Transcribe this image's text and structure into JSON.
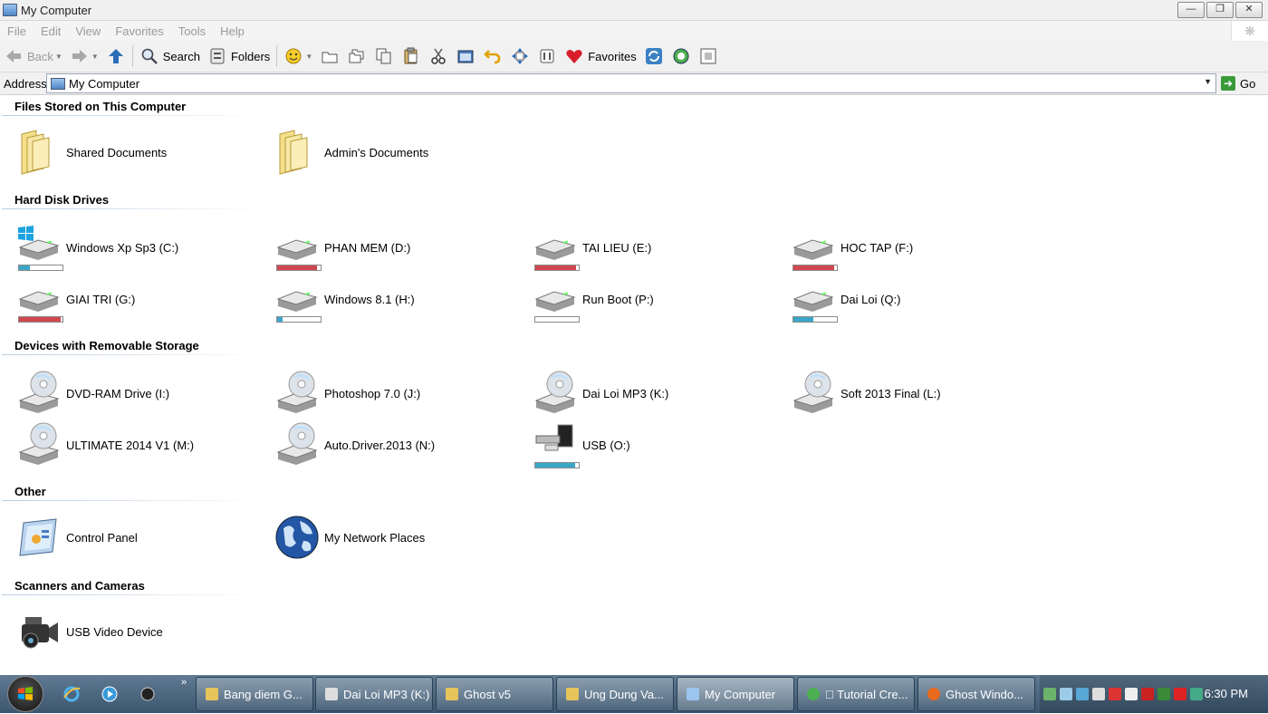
{
  "window": {
    "title": "My Computer"
  },
  "menu": [
    "File",
    "Edit",
    "View",
    "Favorites",
    "Tools",
    "Help"
  ],
  "toolbar": {
    "back": "Back",
    "search": "Search",
    "folders": "Folders",
    "favorites": "Favorites"
  },
  "address": {
    "label": "Address",
    "value": "My Computer",
    "go": "Go"
  },
  "groups": {
    "files": {
      "title": "Files Stored on This Computer",
      "items": [
        {
          "label": "Shared Documents"
        },
        {
          "label": "Admin's Documents"
        }
      ]
    },
    "hdd": {
      "title": "Hard Disk Drives",
      "items": [
        {
          "label": "Windows Xp Sp3 (C:)",
          "usage": 0.25,
          "color": "#3aa6c8"
        },
        {
          "label": "PHAN MEM (D:)",
          "usage": 0.92,
          "color": "#d0484f"
        },
        {
          "label": "TAI LIEU (E:)",
          "usage": 0.94,
          "color": "#d0484f"
        },
        {
          "label": "HOC TAP (F:)",
          "usage": 0.93,
          "color": "#d0484f"
        },
        {
          "label": "GIAI TRI (G:)",
          "usage": 0.95,
          "color": "#d0484f"
        },
        {
          "label": "Windows 8.1 (H:)",
          "usage": 0.12,
          "color": "#3aa6c8"
        },
        {
          "label": "Run Boot (P:)",
          "usage": 0.0,
          "color": "#3aa6c8"
        },
        {
          "label": "Dai Loi (Q:)",
          "usage": 0.45,
          "color": "#3aa6c8"
        }
      ]
    },
    "removable": {
      "title": "Devices with Removable Storage",
      "items": [
        {
          "label": "DVD-RAM Drive (I:)"
        },
        {
          "label": "Photoshop 7.0 (J:)"
        },
        {
          "label": "Dai Loi MP3 (K:)"
        },
        {
          "label": "Soft 2013 Final (L:)"
        },
        {
          "label": "ULTIMATE 2014 V1 (M:)"
        },
        {
          "label": "Auto.Driver.2013 (N:)"
        },
        {
          "label": "USB (O:)",
          "usage": 0.92,
          "color": "#3aa6c8"
        }
      ]
    },
    "other": {
      "title": "Other",
      "items": [
        {
          "label": "Control Panel"
        },
        {
          "label": "My Network Places"
        }
      ]
    },
    "scanners": {
      "title": "Scanners and Cameras",
      "items": [
        {
          "label": "USB Video Device"
        }
      ]
    }
  },
  "taskbar": {
    "tasks": [
      "Bang diem G...",
      "Dai Loi MP3 (K:)",
      "Ghost v5",
      "Ung Dung Va...",
      "My Computer",
      "\u0000 Tutorial Cre...",
      "Ghost Windo..."
    ],
    "clock": "6:30 PM"
  }
}
